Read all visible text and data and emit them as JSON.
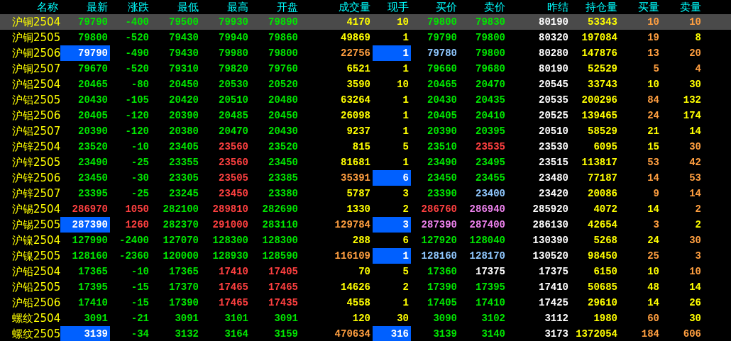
{
  "columns": [
    "名称",
    "最新",
    "涨跌",
    "最低",
    "最高",
    "开盘",
    "成交量",
    "现手",
    "买价",
    "卖价",
    "昨结",
    "持仓量",
    "买量",
    "卖量"
  ],
  "rows": [
    {
      "name": "沪铜2504",
      "selected": true,
      "cells": [
        {
          "text": "79790",
          "color": "#00e600",
          "highlighted": false
        },
        {
          "text": "-400",
          "color": "#00e600",
          "highlighted": false
        },
        {
          "text": "79500",
          "color": "#00e600",
          "highlighted": false
        },
        {
          "text": "79930",
          "color": "#00e600",
          "highlighted": false
        },
        {
          "text": "79890",
          "color": "#00e600",
          "highlighted": false
        },
        {
          "text": "4170",
          "color": "#ffff00",
          "highlighted": false
        },
        {
          "text": "10",
          "color": "#ffff00",
          "highlighted": false
        },
        {
          "text": "79800",
          "color": "#00e600",
          "highlighted": false
        },
        {
          "text": "79830",
          "color": "#00e600",
          "highlighted": false
        },
        {
          "text": "80190",
          "color": "#ffffff",
          "highlighted": false
        },
        {
          "text": "53343",
          "color": "#ffff00",
          "highlighted": false
        },
        {
          "text": "10",
          "color": "#ff9f40",
          "highlighted": false
        },
        {
          "text": "10",
          "color": "#ff9f40",
          "highlighted": false
        }
      ]
    },
    {
      "name": "沪铜2505",
      "selected": false,
      "cells": [
        {
          "text": "79800",
          "color": "#00e600",
          "highlighted": false
        },
        {
          "text": "-520",
          "color": "#00e600",
          "highlighted": false
        },
        {
          "text": "79430",
          "color": "#00e600",
          "highlighted": false
        },
        {
          "text": "79940",
          "color": "#00e600",
          "highlighted": false
        },
        {
          "text": "79860",
          "color": "#00e600",
          "highlighted": false
        },
        {
          "text": "49869",
          "color": "#ffff00",
          "highlighted": false
        },
        {
          "text": "1",
          "color": "#ffff00",
          "highlighted": false
        },
        {
          "text": "79790",
          "color": "#00e600",
          "highlighted": false
        },
        {
          "text": "79800",
          "color": "#00e600",
          "highlighted": false
        },
        {
          "text": "80320",
          "color": "#ffffff",
          "highlighted": false
        },
        {
          "text": "197084",
          "color": "#ffff00",
          "highlighted": false
        },
        {
          "text": "19",
          "color": "#ff9f40",
          "highlighted": false
        },
        {
          "text": "8",
          "color": "#ffff00",
          "highlighted": false
        }
      ]
    },
    {
      "name": "沪铜2506",
      "selected": false,
      "cells": [
        {
          "text": "79790",
          "color": "#ffffff",
          "highlighted": true
        },
        {
          "text": "-490",
          "color": "#00e600",
          "highlighted": false
        },
        {
          "text": "79430",
          "color": "#00e600",
          "highlighted": false
        },
        {
          "text": "79980",
          "color": "#00e600",
          "highlighted": false
        },
        {
          "text": "79800",
          "color": "#00e600",
          "highlighted": false
        },
        {
          "text": "22756",
          "color": "#ff9f40",
          "highlighted": false
        },
        {
          "text": "1",
          "color": "#ffffff",
          "highlighted": true
        },
        {
          "text": "79780",
          "color": "#90c8ff",
          "highlighted": false
        },
        {
          "text": "79800",
          "color": "#00e600",
          "highlighted": false
        },
        {
          "text": "80280",
          "color": "#ffffff",
          "highlighted": false
        },
        {
          "text": "147876",
          "color": "#ffff00",
          "highlighted": false
        },
        {
          "text": "13",
          "color": "#ff9f40",
          "highlighted": false
        },
        {
          "text": "20",
          "color": "#ff9f40",
          "highlighted": false
        }
      ]
    },
    {
      "name": "沪铜2507",
      "selected": false,
      "cells": [
        {
          "text": "79670",
          "color": "#00e600",
          "highlighted": false
        },
        {
          "text": "-520",
          "color": "#00e600",
          "highlighted": false
        },
        {
          "text": "79310",
          "color": "#00e600",
          "highlighted": false
        },
        {
          "text": "79820",
          "color": "#00e600",
          "highlighted": false
        },
        {
          "text": "79760",
          "color": "#00e600",
          "highlighted": false
        },
        {
          "text": "6521",
          "color": "#ffff00",
          "highlighted": false
        },
        {
          "text": "1",
          "color": "#ffff00",
          "highlighted": false
        },
        {
          "text": "79660",
          "color": "#00e600",
          "highlighted": false
        },
        {
          "text": "79680",
          "color": "#00e600",
          "highlighted": false
        },
        {
          "text": "80190",
          "color": "#ffffff",
          "highlighted": false
        },
        {
          "text": "52529",
          "color": "#ffff00",
          "highlighted": false
        },
        {
          "text": "5",
          "color": "#ff9f40",
          "highlighted": false
        },
        {
          "text": "4",
          "color": "#ff9f40",
          "highlighted": false
        }
      ]
    },
    {
      "name": "沪铝2504",
      "selected": false,
      "cells": [
        {
          "text": "20465",
          "color": "#00e600",
          "highlighted": false
        },
        {
          "text": "-80",
          "color": "#00e600",
          "highlighted": false
        },
        {
          "text": "20450",
          "color": "#00e600",
          "highlighted": false
        },
        {
          "text": "20530",
          "color": "#00e600",
          "highlighted": false
        },
        {
          "text": "20520",
          "color": "#00e600",
          "highlighted": false
        },
        {
          "text": "3590",
          "color": "#ffff00",
          "highlighted": false
        },
        {
          "text": "10",
          "color": "#ffff00",
          "highlighted": false
        },
        {
          "text": "20465",
          "color": "#00e600",
          "highlighted": false
        },
        {
          "text": "20470",
          "color": "#00e600",
          "highlighted": false
        },
        {
          "text": "20545",
          "color": "#ffffff",
          "highlighted": false
        },
        {
          "text": "33743",
          "color": "#ffff00",
          "highlighted": false
        },
        {
          "text": "10",
          "color": "#ffff00",
          "highlighted": false
        },
        {
          "text": "30",
          "color": "#ffff00",
          "highlighted": false
        }
      ]
    },
    {
      "name": "沪铝2505",
      "selected": false,
      "cells": [
        {
          "text": "20430",
          "color": "#00e600",
          "highlighted": false
        },
        {
          "text": "-105",
          "color": "#00e600",
          "highlighted": false
        },
        {
          "text": "20420",
          "color": "#00e600",
          "highlighted": false
        },
        {
          "text": "20510",
          "color": "#00e600",
          "highlighted": false
        },
        {
          "text": "20480",
          "color": "#00e600",
          "highlighted": false
        },
        {
          "text": "63264",
          "color": "#ffff00",
          "highlighted": false
        },
        {
          "text": "1",
          "color": "#ffff00",
          "highlighted": false
        },
        {
          "text": "20430",
          "color": "#00e600",
          "highlighted": false
        },
        {
          "text": "20435",
          "color": "#00e600",
          "highlighted": false
        },
        {
          "text": "20535",
          "color": "#ffffff",
          "highlighted": false
        },
        {
          "text": "200296",
          "color": "#ffff00",
          "highlighted": false
        },
        {
          "text": "84",
          "color": "#ff9f40",
          "highlighted": false
        },
        {
          "text": "132",
          "color": "#ffff00",
          "highlighted": false
        }
      ]
    },
    {
      "name": "沪铝2506",
      "selected": false,
      "cells": [
        {
          "text": "20405",
          "color": "#00e600",
          "highlighted": false
        },
        {
          "text": "-120",
          "color": "#00e600",
          "highlighted": false
        },
        {
          "text": "20390",
          "color": "#00e600",
          "highlighted": false
        },
        {
          "text": "20485",
          "color": "#00e600",
          "highlighted": false
        },
        {
          "text": "20450",
          "color": "#00e600",
          "highlighted": false
        },
        {
          "text": "26098",
          "color": "#ffff00",
          "highlighted": false
        },
        {
          "text": "1",
          "color": "#ffff00",
          "highlighted": false
        },
        {
          "text": "20405",
          "color": "#00e600",
          "highlighted": false
        },
        {
          "text": "20410",
          "color": "#00e600",
          "highlighted": false
        },
        {
          "text": "20525",
          "color": "#ffffff",
          "highlighted": false
        },
        {
          "text": "139465",
          "color": "#ffff00",
          "highlighted": false
        },
        {
          "text": "24",
          "color": "#ff9f40",
          "highlighted": false
        },
        {
          "text": "174",
          "color": "#ffff00",
          "highlighted": false
        }
      ]
    },
    {
      "name": "沪铝2507",
      "selected": false,
      "cells": [
        {
          "text": "20390",
          "color": "#00e600",
          "highlighted": false
        },
        {
          "text": "-120",
          "color": "#00e600",
          "highlighted": false
        },
        {
          "text": "20380",
          "color": "#00e600",
          "highlighted": false
        },
        {
          "text": "20470",
          "color": "#00e600",
          "highlighted": false
        },
        {
          "text": "20430",
          "color": "#00e600",
          "highlighted": false
        },
        {
          "text": "9237",
          "color": "#ffff00",
          "highlighted": false
        },
        {
          "text": "1",
          "color": "#ffff00",
          "highlighted": false
        },
        {
          "text": "20390",
          "color": "#00e600",
          "highlighted": false
        },
        {
          "text": "20395",
          "color": "#00e600",
          "highlighted": false
        },
        {
          "text": "20510",
          "color": "#ffffff",
          "highlighted": false
        },
        {
          "text": "58529",
          "color": "#ffff00",
          "highlighted": false
        },
        {
          "text": "21",
          "color": "#ffff00",
          "highlighted": false
        },
        {
          "text": "14",
          "color": "#ffff00",
          "highlighted": false
        }
      ]
    },
    {
      "name": "沪锌2504",
      "selected": false,
      "cells": [
        {
          "text": "23520",
          "color": "#00e600",
          "highlighted": false
        },
        {
          "text": "-10",
          "color": "#00e600",
          "highlighted": false
        },
        {
          "text": "23405",
          "color": "#00e600",
          "highlighted": false
        },
        {
          "text": "23560",
          "color": "#ff4040",
          "highlighted": false
        },
        {
          "text": "23520",
          "color": "#00e600",
          "highlighted": false
        },
        {
          "text": "815",
          "color": "#ffff00",
          "highlighted": false
        },
        {
          "text": "5",
          "color": "#ffff00",
          "highlighted": false
        },
        {
          "text": "23510",
          "color": "#00e600",
          "highlighted": false
        },
        {
          "text": "23535",
          "color": "#ff4040",
          "highlighted": false
        },
        {
          "text": "23530",
          "color": "#ffffff",
          "highlighted": false
        },
        {
          "text": "6095",
          "color": "#ffff00",
          "highlighted": false
        },
        {
          "text": "15",
          "color": "#ffff00",
          "highlighted": false
        },
        {
          "text": "30",
          "color": "#ff9f40",
          "highlighted": false
        }
      ]
    },
    {
      "name": "沪锌2505",
      "selected": false,
      "cells": [
        {
          "text": "23490",
          "color": "#00e600",
          "highlighted": false
        },
        {
          "text": "-25",
          "color": "#00e600",
          "highlighted": false
        },
        {
          "text": "23355",
          "color": "#00e600",
          "highlighted": false
        },
        {
          "text": "23560",
          "color": "#ff4040",
          "highlighted": false
        },
        {
          "text": "23450",
          "color": "#00e600",
          "highlighted": false
        },
        {
          "text": "81681",
          "color": "#ffff00",
          "highlighted": false
        },
        {
          "text": "1",
          "color": "#ffff00",
          "highlighted": false
        },
        {
          "text": "23490",
          "color": "#00e600",
          "highlighted": false
        },
        {
          "text": "23495",
          "color": "#00e600",
          "highlighted": false
        },
        {
          "text": "23515",
          "color": "#ffffff",
          "highlighted": false
        },
        {
          "text": "113817",
          "color": "#ffff00",
          "highlighted": false
        },
        {
          "text": "53",
          "color": "#ff9f40",
          "highlighted": false
        },
        {
          "text": "42",
          "color": "#ff9f40",
          "highlighted": false
        }
      ]
    },
    {
      "name": "沪锌2506",
      "selected": false,
      "cells": [
        {
          "text": "23450",
          "color": "#00e600",
          "highlighted": false
        },
        {
          "text": "-30",
          "color": "#00e600",
          "highlighted": false
        },
        {
          "text": "23305",
          "color": "#00e600",
          "highlighted": false
        },
        {
          "text": "23505",
          "color": "#ff4040",
          "highlighted": false
        },
        {
          "text": "23385",
          "color": "#00e600",
          "highlighted": false
        },
        {
          "text": "35391",
          "color": "#ff9f40",
          "highlighted": false
        },
        {
          "text": "6",
          "color": "#ffffff",
          "highlighted": true
        },
        {
          "text": "23450",
          "color": "#00e600",
          "highlighted": false
        },
        {
          "text": "23455",
          "color": "#00e600",
          "highlighted": false
        },
        {
          "text": "23480",
          "color": "#ffffff",
          "highlighted": false
        },
        {
          "text": "77187",
          "color": "#ffff00",
          "highlighted": false
        },
        {
          "text": "14",
          "color": "#ff9f40",
          "highlighted": false
        },
        {
          "text": "53",
          "color": "#ff9f40",
          "highlighted": false
        }
      ]
    },
    {
      "name": "沪锌2507",
      "selected": false,
      "cells": [
        {
          "text": "23395",
          "color": "#00e600",
          "highlighted": false
        },
        {
          "text": "-25",
          "color": "#00e600",
          "highlighted": false
        },
        {
          "text": "23245",
          "color": "#00e600",
          "highlighted": false
        },
        {
          "text": "23450",
          "color": "#ff4040",
          "highlighted": false
        },
        {
          "text": "23380",
          "color": "#00e600",
          "highlighted": false
        },
        {
          "text": "5787",
          "color": "#ffff00",
          "highlighted": false
        },
        {
          "text": "3",
          "color": "#ffff00",
          "highlighted": false
        },
        {
          "text": "23390",
          "color": "#00e600",
          "highlighted": false
        },
        {
          "text": "23400",
          "color": "#90c8ff",
          "highlighted": false
        },
        {
          "text": "23420",
          "color": "#ffffff",
          "highlighted": false
        },
        {
          "text": "20086",
          "color": "#ffff00",
          "highlighted": false
        },
        {
          "text": "9",
          "color": "#ff9f40",
          "highlighted": false
        },
        {
          "text": "14",
          "color": "#ff9f40",
          "highlighted": false
        }
      ]
    },
    {
      "name": "沪锡2504",
      "selected": false,
      "cells": [
        {
          "text": "286970",
          "color": "#ff4040",
          "highlighted": false
        },
        {
          "text": "1050",
          "color": "#ff4040",
          "highlighted": false
        },
        {
          "text": "282100",
          "color": "#00e600",
          "highlighted": false
        },
        {
          "text": "289810",
          "color": "#ff4040",
          "highlighted": false
        },
        {
          "text": "282690",
          "color": "#00e600",
          "highlighted": false
        },
        {
          "text": "1330",
          "color": "#ffff00",
          "highlighted": false
        },
        {
          "text": "2",
          "color": "#ffff00",
          "highlighted": false
        },
        {
          "text": "286760",
          "color": "#ff4040",
          "highlighted": false
        },
        {
          "text": "286940",
          "color": "#ee82ee",
          "highlighted": false
        },
        {
          "text": "285920",
          "color": "#ffffff",
          "highlighted": false
        },
        {
          "text": "4072",
          "color": "#ffff00",
          "highlighted": false
        },
        {
          "text": "14",
          "color": "#ffff00",
          "highlighted": false
        },
        {
          "text": "2",
          "color": "#ff9f40",
          "highlighted": false
        }
      ]
    },
    {
      "name": "沪锡2505",
      "selected": false,
      "cells": [
        {
          "text": "287390",
          "color": "#ffffff",
          "highlighted": true
        },
        {
          "text": "1260",
          "color": "#ff4040",
          "highlighted": false
        },
        {
          "text": "282370",
          "color": "#00e600",
          "highlighted": false
        },
        {
          "text": "291000",
          "color": "#ff4040",
          "highlighted": false
        },
        {
          "text": "283110",
          "color": "#00e600",
          "highlighted": false
        },
        {
          "text": "129784",
          "color": "#ff9f40",
          "highlighted": false
        },
        {
          "text": "3",
          "color": "#ffffff",
          "highlighted": true
        },
        {
          "text": "287390",
          "color": "#ee82ee",
          "highlighted": false
        },
        {
          "text": "287400",
          "color": "#ee82ee",
          "highlighted": false
        },
        {
          "text": "286130",
          "color": "#ffffff",
          "highlighted": false
        },
        {
          "text": "42654",
          "color": "#ffff00",
          "highlighted": false
        },
        {
          "text": "3",
          "color": "#ff9f40",
          "highlighted": false
        },
        {
          "text": "2",
          "color": "#ffff00",
          "highlighted": false
        }
      ]
    },
    {
      "name": "沪镍2504",
      "selected": false,
      "cells": [
        {
          "text": "127990",
          "color": "#00e600",
          "highlighted": false
        },
        {
          "text": "-2400",
          "color": "#00e600",
          "highlighted": false
        },
        {
          "text": "127070",
          "color": "#00e600",
          "highlighted": false
        },
        {
          "text": "128300",
          "color": "#00e600",
          "highlighted": false
        },
        {
          "text": "128300",
          "color": "#00e600",
          "highlighted": false
        },
        {
          "text": "288",
          "color": "#ffff00",
          "highlighted": false
        },
        {
          "text": "6",
          "color": "#ffff00",
          "highlighted": false
        },
        {
          "text": "127920",
          "color": "#00e600",
          "highlighted": false
        },
        {
          "text": "128040",
          "color": "#00e600",
          "highlighted": false
        },
        {
          "text": "130390",
          "color": "#ffffff",
          "highlighted": false
        },
        {
          "text": "5268",
          "color": "#ffff00",
          "highlighted": false
        },
        {
          "text": "24",
          "color": "#ffff00",
          "highlighted": false
        },
        {
          "text": "30",
          "color": "#ff9f40",
          "highlighted": false
        }
      ]
    },
    {
      "name": "沪镍2505",
      "selected": false,
      "cells": [
        {
          "text": "128160",
          "color": "#00e600",
          "highlighted": false
        },
        {
          "text": "-2360",
          "color": "#00e600",
          "highlighted": false
        },
        {
          "text": "120000",
          "color": "#00e600",
          "highlighted": false
        },
        {
          "text": "128930",
          "color": "#00e600",
          "highlighted": false
        },
        {
          "text": "128590",
          "color": "#00e600",
          "highlighted": false
        },
        {
          "text": "116109",
          "color": "#ff9f40",
          "highlighted": false
        },
        {
          "text": "1",
          "color": "#ffffff",
          "highlighted": true
        },
        {
          "text": "128160",
          "color": "#90c8ff",
          "highlighted": false
        },
        {
          "text": "128170",
          "color": "#90c8ff",
          "highlighted": false
        },
        {
          "text": "130520",
          "color": "#ffffff",
          "highlighted": false
        },
        {
          "text": "98450",
          "color": "#ffff00",
          "highlighted": false
        },
        {
          "text": "25",
          "color": "#ff9f40",
          "highlighted": false
        },
        {
          "text": "3",
          "color": "#ff9f40",
          "highlighted": false
        }
      ]
    },
    {
      "name": "沪铅2504",
      "selected": false,
      "cells": [
        {
          "text": "17365",
          "color": "#00e600",
          "highlighted": false
        },
        {
          "text": "-10",
          "color": "#00e600",
          "highlighted": false
        },
        {
          "text": "17365",
          "color": "#00e600",
          "highlighted": false
        },
        {
          "text": "17410",
          "color": "#ff4040",
          "highlighted": false
        },
        {
          "text": "17405",
          "color": "#ff4040",
          "highlighted": false
        },
        {
          "text": "70",
          "color": "#ffff00",
          "highlighted": false
        },
        {
          "text": "5",
          "color": "#ffff00",
          "highlighted": false
        },
        {
          "text": "17360",
          "color": "#00e600",
          "highlighted": false
        },
        {
          "text": "17375",
          "color": "#ffffff",
          "highlighted": false
        },
        {
          "text": "17375",
          "color": "#ffffff",
          "highlighted": false
        },
        {
          "text": "6150",
          "color": "#ffff00",
          "highlighted": false
        },
        {
          "text": "10",
          "color": "#ffff00",
          "highlighted": false
        },
        {
          "text": "10",
          "color": "#ff9f40",
          "highlighted": false
        }
      ]
    },
    {
      "name": "沪铅2505",
      "selected": false,
      "cells": [
        {
          "text": "17395",
          "color": "#00e600",
          "highlighted": false
        },
        {
          "text": "-15",
          "color": "#00e600",
          "highlighted": false
        },
        {
          "text": "17370",
          "color": "#00e600",
          "highlighted": false
        },
        {
          "text": "17465",
          "color": "#ff4040",
          "highlighted": false
        },
        {
          "text": "17465",
          "color": "#ff4040",
          "highlighted": false
        },
        {
          "text": "14626",
          "color": "#ffff00",
          "highlighted": false
        },
        {
          "text": "2",
          "color": "#ffff00",
          "highlighted": false
        },
        {
          "text": "17390",
          "color": "#00e600",
          "highlighted": false
        },
        {
          "text": "17395",
          "color": "#00e600",
          "highlighted": false
        },
        {
          "text": "17410",
          "color": "#ffffff",
          "highlighted": false
        },
        {
          "text": "50685",
          "color": "#ffff00",
          "highlighted": false
        },
        {
          "text": "48",
          "color": "#ffff00",
          "highlighted": false
        },
        {
          "text": "14",
          "color": "#ffff00",
          "highlighted": false
        }
      ]
    },
    {
      "name": "沪铅2506",
      "selected": false,
      "cells": [
        {
          "text": "17410",
          "color": "#00e600",
          "highlighted": false
        },
        {
          "text": "-15",
          "color": "#00e600",
          "highlighted": false
        },
        {
          "text": "17390",
          "color": "#00e600",
          "highlighted": false
        },
        {
          "text": "17465",
          "color": "#ff4040",
          "highlighted": false
        },
        {
          "text": "17435",
          "color": "#ff4040",
          "highlighted": false
        },
        {
          "text": "4558",
          "color": "#ffff00",
          "highlighted": false
        },
        {
          "text": "1",
          "color": "#ffff00",
          "highlighted": false
        },
        {
          "text": "17405",
          "color": "#00e600",
          "highlighted": false
        },
        {
          "text": "17410",
          "color": "#00e600",
          "highlighted": false
        },
        {
          "text": "17425",
          "color": "#ffffff",
          "highlighted": false
        },
        {
          "text": "29610",
          "color": "#ffff00",
          "highlighted": false
        },
        {
          "text": "14",
          "color": "#ffff00",
          "highlighted": false
        },
        {
          "text": "26",
          "color": "#ffff00",
          "highlighted": false
        }
      ]
    },
    {
      "name": "螺纹2504",
      "selected": false,
      "cells": [
        {
          "text": "3091",
          "color": "#00e600",
          "highlighted": false
        },
        {
          "text": "-21",
          "color": "#00e600",
          "highlighted": false
        },
        {
          "text": "3091",
          "color": "#00e600",
          "highlighted": false
        },
        {
          "text": "3101",
          "color": "#00e600",
          "highlighted": false
        },
        {
          "text": "3091",
          "color": "#00e600",
          "highlighted": false
        },
        {
          "text": "120",
          "color": "#ffff00",
          "highlighted": false
        },
        {
          "text": "30",
          "color": "#ffff00",
          "highlighted": false
        },
        {
          "text": "3090",
          "color": "#00e600",
          "highlighted": false
        },
        {
          "text": "3102",
          "color": "#00e600",
          "highlighted": false
        },
        {
          "text": "3112",
          "color": "#ffffff",
          "highlighted": false
        },
        {
          "text": "1980",
          "color": "#ffff00",
          "highlighted": false
        },
        {
          "text": "60",
          "color": "#ff9f40",
          "highlighted": false
        },
        {
          "text": "30",
          "color": "#ffff00",
          "highlighted": false
        }
      ]
    },
    {
      "name": "螺纹2505",
      "selected": false,
      "cells": [
        {
          "text": "3139",
          "color": "#ffffff",
          "highlighted": true
        },
        {
          "text": "-34",
          "color": "#00e600",
          "highlighted": false
        },
        {
          "text": "3132",
          "color": "#00e600",
          "highlighted": false
        },
        {
          "text": "3164",
          "color": "#00e600",
          "highlighted": false
        },
        {
          "text": "3159",
          "color": "#00e600",
          "highlighted": false
        },
        {
          "text": "470634",
          "color": "#ff9f40",
          "highlighted": false
        },
        {
          "text": "316",
          "color": "#ffffff",
          "highlighted": true
        },
        {
          "text": "3139",
          "color": "#00e600",
          "highlighted": false
        },
        {
          "text": "3140",
          "color": "#00e600",
          "highlighted": false
        },
        {
          "text": "3173",
          "color": "#ffffff",
          "highlighted": false
        },
        {
          "text": "1372054",
          "color": "#ffff00",
          "highlighted": false
        },
        {
          "text": "184",
          "color": "#ff9f40",
          "highlighted": false
        },
        {
          "text": "606",
          "color": "#ff9f40",
          "highlighted": false
        }
      ]
    }
  ]
}
